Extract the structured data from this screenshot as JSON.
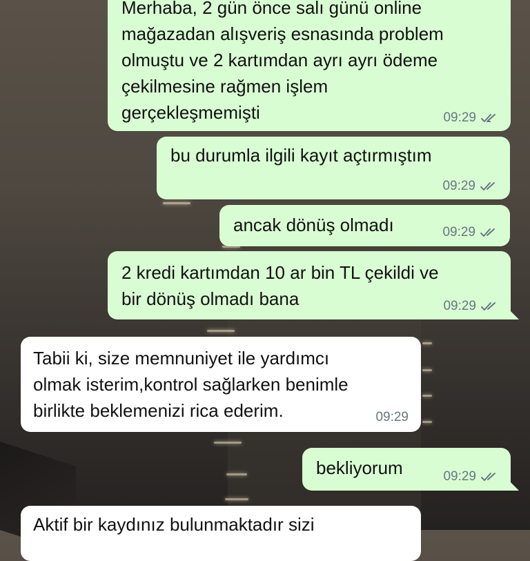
{
  "chat": {
    "messages": [
      {
        "direction": "outgoing",
        "text": "Merhaba, 2 gün önce salı günü online\nmağazadan alışveriş esnasında problem\nolmuştu ve 2 kartımdan ayrı ayrı ödeme\nçekilmesine rağmen işlem\ngerçekleşmemişti",
        "time": "09:29",
        "status": "read"
      },
      {
        "direction": "outgoing",
        "text": "bu durumla ilgili kayıt açtırmıştım",
        "time": "09:29",
        "status": "read"
      },
      {
        "direction": "outgoing",
        "text": "ancak dönüş olmadı",
        "time": "09:29",
        "status": "read"
      },
      {
        "direction": "outgoing",
        "text": "2 kredi kartımdan 10 ar bin TL çekildi ve\nbir dönüş olmadı bana",
        "time": "09:29",
        "status": "read"
      },
      {
        "direction": "incoming",
        "text": "Tabii ki, size memnuniyet ile yardımcı\nolmak isterim,kontrol sağlarken benimle\nbirlikte beklemenizi rica ederim.",
        "time": "09:29"
      },
      {
        "direction": "outgoing",
        "text": "bekliyorum",
        "time": "09:29",
        "status": "read"
      },
      {
        "direction": "incoming",
        "text": "Aktif bir kaydınız bulunmaktadır sizi"
      }
    ]
  },
  "colors": {
    "outgoing_bubble": "#d9fdd3",
    "incoming_bubble": "#ffffff",
    "timestamp": "#667781",
    "read_ticks": "#667781"
  },
  "icons": {
    "read_receipt": "double-check-icon"
  }
}
